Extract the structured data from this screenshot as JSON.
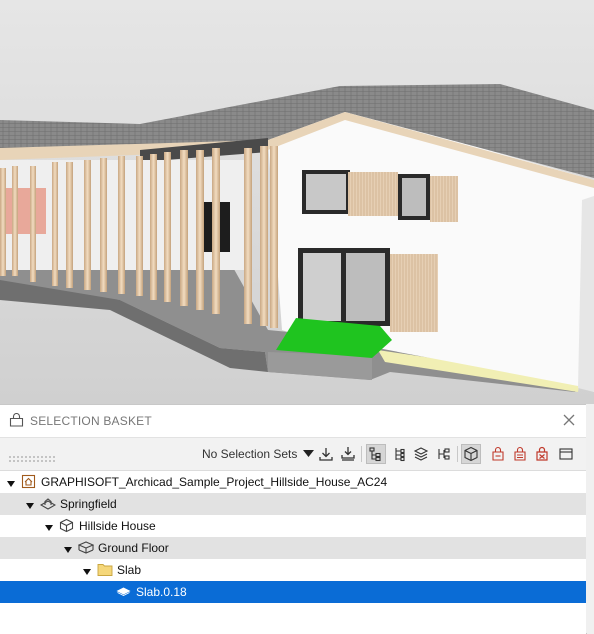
{
  "panel": {
    "title": "SELECTION BASKET",
    "selection_sets_label": "No Selection Sets"
  },
  "toolbar": {
    "icons": [
      "import-icon",
      "import-all-icon",
      "tree-view-icon",
      "tree-view-icon-2",
      "layers-view-icon",
      "hierarchy-view-icon",
      "object-3d-icon",
      "remove-selection-icon",
      "remove-from-basket-icon",
      "clear-basket-icon",
      "window-toggle-icon"
    ]
  },
  "tree": {
    "rows": [
      {
        "label": "GRAPHISOFT_Archicad_Sample_Project_Hillside_House_AC24",
        "icon": "project-icon"
      },
      {
        "label": "Springfield",
        "icon": "site-icon"
      },
      {
        "label": "Hillside House",
        "icon": "building-icon"
      },
      {
        "label": "Ground Floor",
        "icon": "floor-icon"
      },
      {
        "label": "Slab",
        "icon": "folder-icon"
      },
      {
        "label": "Slab.0.18",
        "icon": "slab-icon"
      }
    ]
  },
  "colors": {
    "selection": "#0a6cd6",
    "alt_row": "#e2e2e2",
    "grass": "#1fc41f",
    "wall": "#fafafa"
  }
}
